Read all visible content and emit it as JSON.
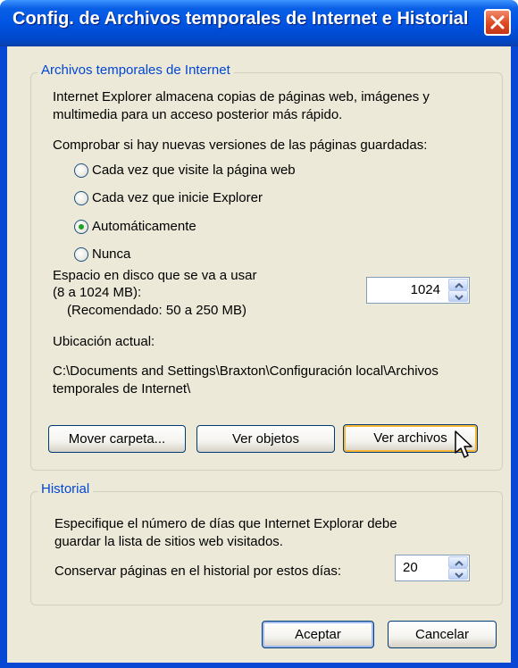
{
  "window": {
    "title": "Config. de Archivos temporales de Internet e Historial"
  },
  "temp_files": {
    "legend": "Archivos temporales de Internet",
    "description_line1": "Internet Explorer almacena copias de páginas web, imágenes y",
    "description_line2": "multimedia para un acceso posterior más rápido.",
    "check_label": "Comprobar si hay nuevas versiones de las páginas guardadas:",
    "options": [
      {
        "label": "Cada vez que visite la página web",
        "selected": false
      },
      {
        "label": "Cada vez que inicie Explorer",
        "selected": false
      },
      {
        "label": "Automáticamente",
        "selected": true
      },
      {
        "label": "Nunca",
        "selected": false
      }
    ],
    "disk_space_line1": "Espacio en disco que se va a usar",
    "disk_space_line2": "(8 a 1024 MB):",
    "disk_space_line3": "(Recomendado: 50 a 250 MB)",
    "disk_space_value": "1024",
    "location_label": "Ubicación actual:",
    "location_line1": "C:\\Documents and Settings\\Braxton\\Configuración local\\Archivos",
    "location_line2": "temporales de Internet\\",
    "move_folder_label": "Mover carpeta...",
    "view_objects_label": "Ver objetos",
    "view_files_label": "Ver archivos"
  },
  "history": {
    "legend": "Historial",
    "description_line1": "Especifique el número de días que Internet Explorar debe",
    "description_line2": "guardar la lista de sitios web visitados.",
    "days_label": "Conservar páginas en el historial por estos días:",
    "days_value": "20"
  },
  "footer": {
    "ok_label": "Aceptar",
    "cancel_label": "Cancelar"
  },
  "colors": {
    "titlebar": "#0054e3",
    "legend_text": "#0046d5",
    "dialog_bg": "#ece9d8",
    "close_button": "#dc4a23"
  }
}
